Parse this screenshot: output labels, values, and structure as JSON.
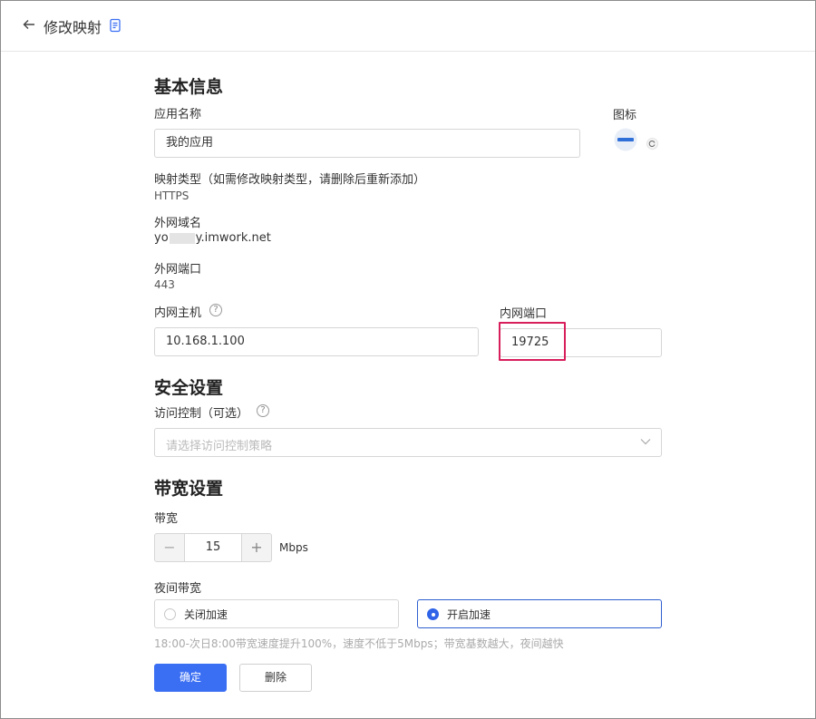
{
  "header": {
    "title": "修改映射"
  },
  "basic": {
    "section_title": "基本信息",
    "app_name_label": "应用名称",
    "app_name_value": "我的应用",
    "icon_label": "图标",
    "mapping_type_label": "映射类型（如需修改映射类型，请删除后重新添加）",
    "mapping_type_value": "HTTPS",
    "domain_label": "外网域名",
    "domain_prefix": "yo",
    "domain_suffix": "y.imwork.net",
    "external_port_label": "外网端口",
    "external_port_value": "443",
    "internal_host_label": "内网主机",
    "internal_host_value": "10.168.1.100",
    "internal_port_label": "内网端口",
    "internal_port_value": "19725"
  },
  "security": {
    "section_title": "安全设置",
    "access_control_label": "访问控制（可选）",
    "access_control_placeholder": "请选择访问控制策略"
  },
  "bandwidth": {
    "section_title": "带宽设置",
    "bandwidth_label": "带宽",
    "bandwidth_value": "15",
    "unit": "Mbps",
    "night_label": "夜间带宽",
    "options": [
      {
        "label": "关闭加速",
        "selected": false
      },
      {
        "label": "开启加速",
        "selected": true
      }
    ],
    "hint": "18:00-次日8:00带宽速度提升100%，速度不低于5Mbps；带宽基数越大，夜间越快"
  },
  "actions": {
    "confirm": "确定",
    "delete": "删除"
  },
  "colors": {
    "primary": "#3a6ef3",
    "highlight": "#d81e5b"
  }
}
